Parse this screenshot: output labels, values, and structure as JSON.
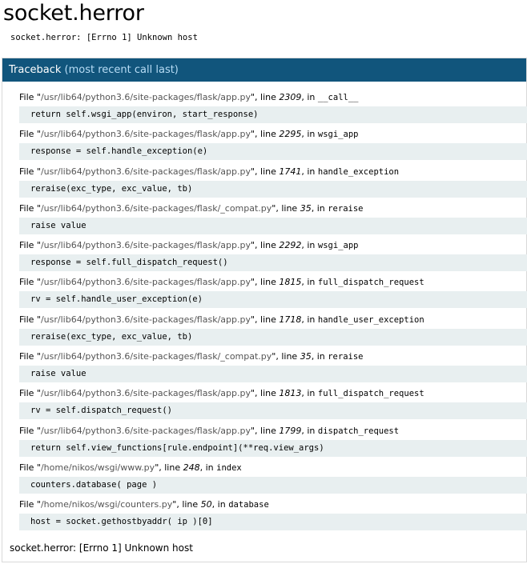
{
  "title": "socket.herror",
  "summary": "socket.herror: [Errno 1] Unknown host",
  "traceback": {
    "header_main": "Traceback",
    "header_sub": "(most recent call last)",
    "frames": [
      {
        "file": "/usr/lib64/python3.6/site-packages/flask/app.py",
        "line": "2309",
        "function": "__call__",
        "source": "return self.wsgi_app(environ, start_response)"
      },
      {
        "file": "/usr/lib64/python3.6/site-packages/flask/app.py",
        "line": "2295",
        "function": "wsgi_app",
        "source": "response = self.handle_exception(e)"
      },
      {
        "file": "/usr/lib64/python3.6/site-packages/flask/app.py",
        "line": "1741",
        "function": "handle_exception",
        "source": "reraise(exc_type, exc_value, tb)"
      },
      {
        "file": "/usr/lib64/python3.6/site-packages/flask/_compat.py",
        "line": "35",
        "function": "reraise",
        "source": "raise value"
      },
      {
        "file": "/usr/lib64/python3.6/site-packages/flask/app.py",
        "line": "2292",
        "function": "wsgi_app",
        "source": "response = self.full_dispatch_request()"
      },
      {
        "file": "/usr/lib64/python3.6/site-packages/flask/app.py",
        "line": "1815",
        "function": "full_dispatch_request",
        "source": "rv = self.handle_user_exception(e)"
      },
      {
        "file": "/usr/lib64/python3.6/site-packages/flask/app.py",
        "line": "1718",
        "function": "handle_user_exception",
        "source": "reraise(exc_type, exc_value, tb)"
      },
      {
        "file": "/usr/lib64/python3.6/site-packages/flask/_compat.py",
        "line": "35",
        "function": "reraise",
        "source": "raise value"
      },
      {
        "file": "/usr/lib64/python3.6/site-packages/flask/app.py",
        "line": "1813",
        "function": "full_dispatch_request",
        "source": "rv = self.dispatch_request()"
      },
      {
        "file": "/usr/lib64/python3.6/site-packages/flask/app.py",
        "line": "1799",
        "function": "dispatch_request",
        "source": "return self.view_functions[rule.endpoint](**req.view_args)"
      },
      {
        "file": "/home/nikos/wsgi/www.py",
        "line": "248",
        "function": "index",
        "source": "counters.database( page )"
      },
      {
        "file": "/home/nikos/wsgi/counters.py",
        "line": "50",
        "function": "database",
        "source": "host = socket.gethostbyaddr( ip )[0]"
      }
    ],
    "footer": "socket.herror: [Errno 1] Unknown host"
  },
  "labels": {
    "file_prefix": "File ",
    "line_prefix": ", line ",
    "in_prefix": ", in "
  }
}
